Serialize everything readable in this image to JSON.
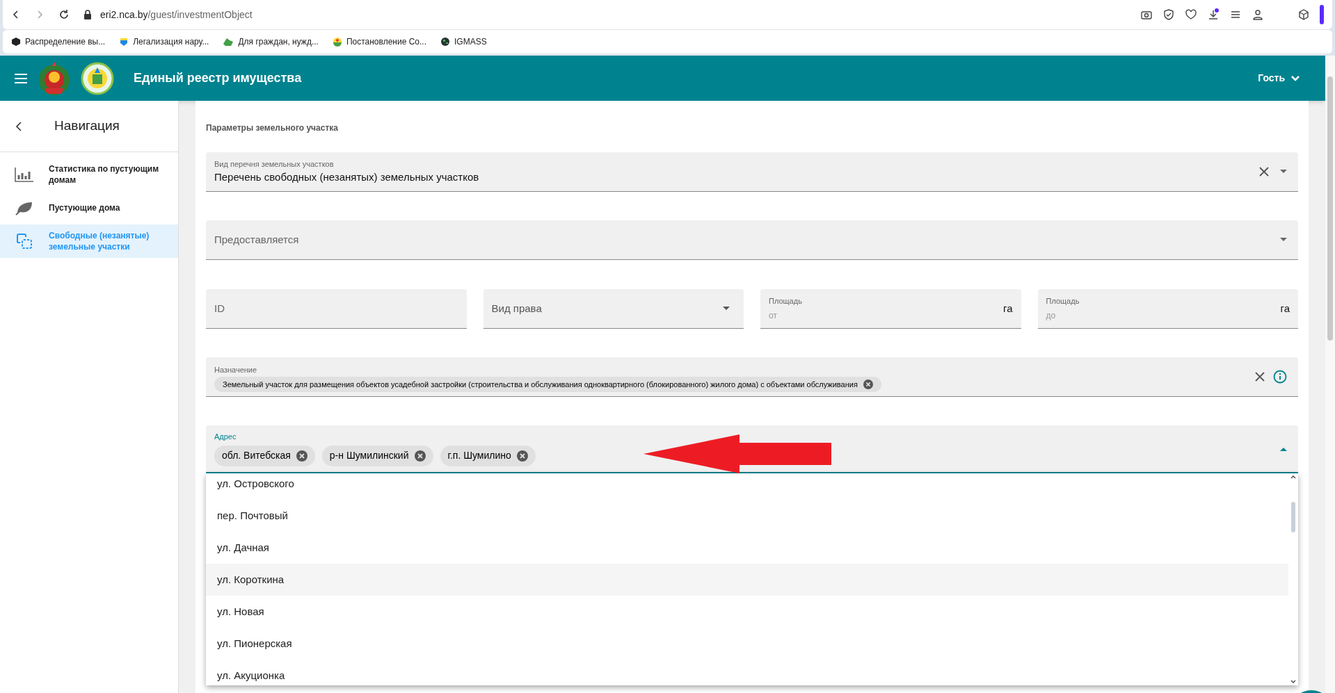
{
  "browser": {
    "url_host": "eri2.nca.by",
    "url_path": "/guest/investmentObject",
    "bookmarks": [
      {
        "label": "Распределение вы..."
      },
      {
        "label": "Легализация нару..."
      },
      {
        "label": "Для граждан, нужд..."
      },
      {
        "label": "Постановление Со..."
      },
      {
        "label": "IGMASS"
      }
    ]
  },
  "header": {
    "title": "Единый реестр имущества",
    "user": "Гость"
  },
  "sidebar": {
    "title": "Навигация",
    "items": [
      {
        "label": "Статистика по пустующим домам",
        "kind": "chart",
        "selected": false
      },
      {
        "label": "Пустующие дома",
        "kind": "leaf",
        "selected": false
      },
      {
        "label": "Свободные (незанятые) земельные участки",
        "kind": "plots",
        "selected": true
      }
    ]
  },
  "form": {
    "section_title": "Параметры земельного участка",
    "list_type": {
      "label": "Вид перечня земельных участков",
      "value": "Перечень свободных (незанятых) земельных участков"
    },
    "provided": {
      "placeholder": "Предоставляется"
    },
    "row": [
      {
        "kind": "text",
        "placeholder": "ID"
      },
      {
        "kind": "select",
        "placeholder": "Вид права"
      },
      {
        "kind": "unit",
        "label": "Площадь",
        "placeholder": "от",
        "unit": "га"
      },
      {
        "kind": "unit",
        "label": "Площадь",
        "placeholder": "до",
        "unit": "га"
      }
    ],
    "purpose": {
      "label": "Назначение",
      "chips": [
        "Земельный участок для размещения объектов усадебной застройки (строительства и обслуживания одноквартирного (блокированного) жилого дома) с объектами обслуживания"
      ]
    },
    "address": {
      "label": "Адрес",
      "expanded": true,
      "chips": [
        "обл. Витебская",
        "р-н Шумилинский",
        "г.п. Шумилино"
      ],
      "options": [
        {
          "label": "ул. Островского",
          "hovered": false
        },
        {
          "label": "пер. Почтовый",
          "hovered": false
        },
        {
          "label": "ул. Дачная",
          "hovered": false
        },
        {
          "label": "ул. Короткина",
          "hovered": true
        },
        {
          "label": "ул. Новая",
          "hovered": false
        },
        {
          "label": "ул. Пионерская",
          "hovered": false
        },
        {
          "label": "ул. Акуционка",
          "hovered": false
        }
      ]
    }
  }
}
